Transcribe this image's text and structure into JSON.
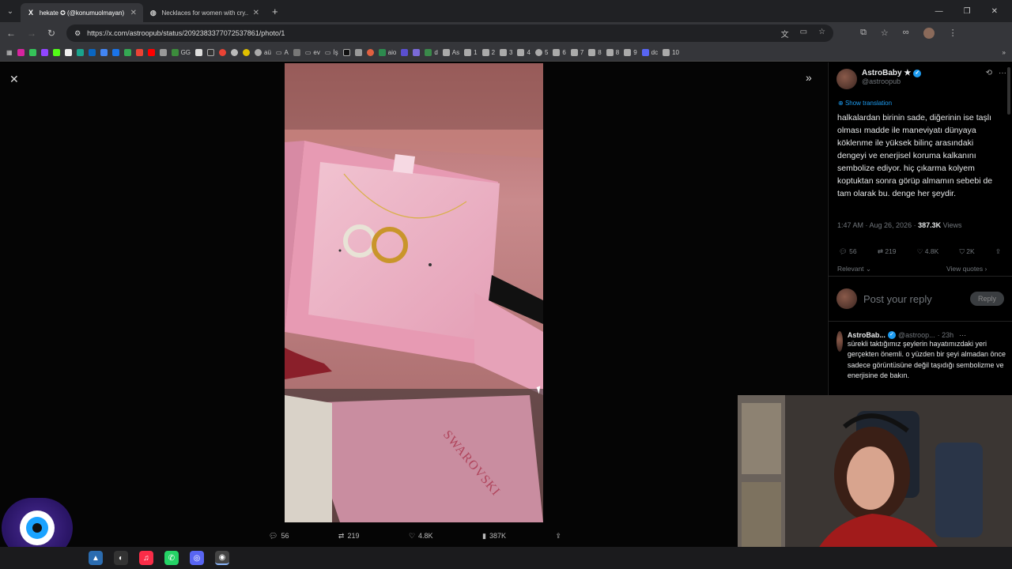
{
  "browser": {
    "tabs": [
      {
        "label": "hekate ✪ (@konumuolmayan)",
        "favicon": "X"
      },
      {
        "label": "Necklaces for women with cry...",
        "favicon": "globe"
      }
    ],
    "new_tab": "+",
    "url": "https://x.com/astroopub/status/2092383377072537861/photo/1",
    "bookmarks": [
      "GG",
      "aü",
      "A",
      "ev",
      "İş",
      "aio",
      "d",
      "As",
      "1",
      "2",
      "3",
      "4",
      "5",
      "6",
      "7",
      "8",
      "8",
      "9",
      "dc",
      "10"
    ]
  },
  "media_actions": {
    "replies": "56",
    "reposts": "219",
    "likes": "4.8K",
    "views": "387K"
  },
  "tweet": {
    "name": "AstroBaby ★",
    "handle": "@astroopub",
    "show_translation": "Show translation",
    "text": "halkalardan birinin sade, diğerinin ise taşlı olması madde ile maneviyatı dünyaya köklenme ile yüksek bilinç arasındaki dengeyi ve enerjisel koruma kalkanını sembolize ediyor. hiç çıkarma kolyem koptuktan sonra görüp almamın sebebi de tam olarak bu. denge her şeydir.",
    "time": "1:47 AM · Aug 26, 2026 · ",
    "views_count": "387.3K",
    "views_label": " Views",
    "actions": {
      "replies": "56",
      "reposts": "219",
      "likes": "4.8K",
      "bookmarks": "2K"
    },
    "relevant": "Relevant",
    "view_quotes": "View quotes"
  },
  "reply_box": {
    "placeholder": "Post your reply",
    "button": "Reply"
  },
  "reply": {
    "name": "AstroBab...",
    "handle": "@astroop...",
    "time": "· 23h",
    "text": "sürekli taktığımız şeylerin hayatımızdaki yeri gerçekten önemli. o yüzden bir şeyi almadan önce sadece görüntüsüne değil taşıdığı sembolizme ve enerjisine de bakın."
  },
  "photo": {
    "brand_text": "SWAROVSKI"
  },
  "colors": {
    "accent": "#1d9bf0",
    "box_pink": "#e8a9bf"
  }
}
